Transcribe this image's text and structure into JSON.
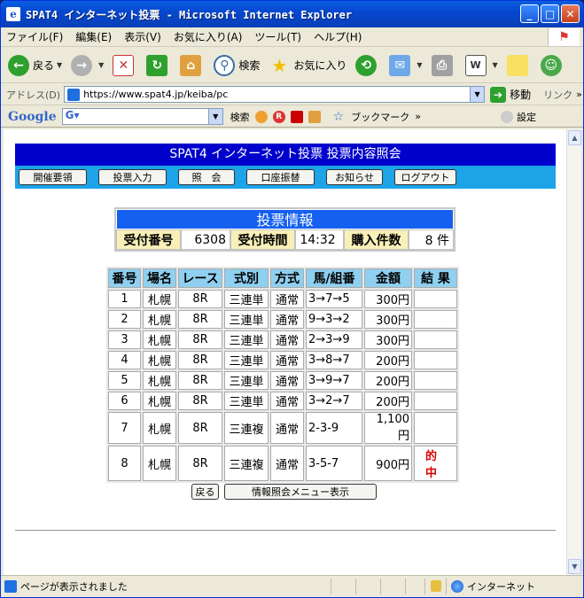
{
  "window": {
    "title": "SPAT4 インターネット投票 - Microsoft Internet Explorer",
    "minimize": "_",
    "maximize": "□",
    "close": "✕"
  },
  "menu": [
    "ファイル(F)",
    "編集(E)",
    "表示(V)",
    "お気に入り(A)",
    "ツール(T)",
    "ヘルプ(H)"
  ],
  "toolbar": {
    "back": "戻る",
    "search": "検索",
    "favorites": "お気に入り"
  },
  "address": {
    "label": "アドレス(D)",
    "url": "https://www.spat4.jp/keiba/pc",
    "go": "移動",
    "links": "リンク"
  },
  "googlebar": {
    "logo": "Google",
    "search": "検索",
    "bookmarks": "ブックマーク",
    "settings": "設定"
  },
  "page": {
    "banner": "SPAT4 インターネット投票 投票内容照会",
    "nav": [
      "開催要領",
      "投票入力",
      "照　会",
      "口座振替",
      "お知らせ",
      "ログアウト"
    ],
    "info": {
      "title": "投票情報",
      "receipt_label": "受付番号",
      "receipt_value": "6308",
      "time_label": "受付時間",
      "time_value": "14:32",
      "count_label": "購入件数",
      "count_value": "8 件"
    },
    "bets": {
      "headers": [
        "番号",
        "場名",
        "レース",
        "式別",
        "方式",
        "馬/組番",
        "金額",
        "結 果"
      ],
      "rows": [
        [
          "1",
          "札幌",
          "8R",
          "三連単",
          "通常",
          "3→7→5",
          "300円",
          ""
        ],
        [
          "2",
          "札幌",
          "8R",
          "三連単",
          "通常",
          "9→3→2",
          "300円",
          ""
        ],
        [
          "3",
          "札幌",
          "8R",
          "三連単",
          "通常",
          "2→3→9",
          "300円",
          ""
        ],
        [
          "4",
          "札幌",
          "8R",
          "三連単",
          "通常",
          "3→8→7",
          "200円",
          ""
        ],
        [
          "5",
          "札幌",
          "8R",
          "三連単",
          "通常",
          "3→9→7",
          "200円",
          ""
        ],
        [
          "6",
          "札幌",
          "8R",
          "三連単",
          "通常",
          "3→2→7",
          "200円",
          ""
        ],
        [
          "7",
          "札幌",
          "8R",
          "三連複",
          "通常",
          "2-3-9",
          "1,100円",
          ""
        ],
        [
          "8",
          "札幌",
          "8R",
          "三連複",
          "通常",
          "3-5-7",
          "900円",
          "的中"
        ]
      ]
    },
    "back_button": "戻る",
    "menu_button": "情報照会メニュー表示"
  },
  "status": {
    "text": "ページが表示されました",
    "zone": "インターネット"
  }
}
